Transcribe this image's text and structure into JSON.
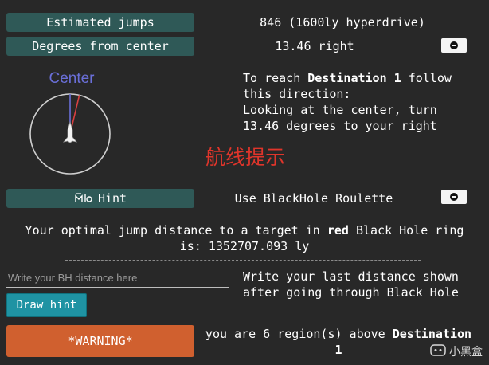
{
  "rows": {
    "jumps": {
      "label": "Estimated jumps",
      "value": "846 (1600ly hyperdrive)"
    },
    "degrees": {
      "label": "Degrees from center",
      "value": "13.46 right"
    }
  },
  "compass": {
    "label": "Center",
    "heading_degrees": 13.46,
    "colors": {
      "center_line": "#7b6ad8",
      "heading_line": "#d84040"
    }
  },
  "instructions": {
    "line1_prefix": "To reach ",
    "destination": "Destination 1",
    "line1_suffix": " follow",
    "line2": "this direction:",
    "line3": "Looking at the center, turn",
    "line4": "13.46 degrees to your right"
  },
  "overlay_caption": "航线提示",
  "hint": {
    "label": "Hint",
    "roulette_text": "Use BlackHole Roulette"
  },
  "optimal": {
    "prefix": "Your optimal jump distance to a target in ",
    "color_word": "red",
    "suffix": " Black Hole ring",
    "line2": "is: 1352707.093 ly"
  },
  "bh_input": {
    "placeholder": "Write your BH distance here",
    "value": ""
  },
  "bh_note": {
    "line1": "Write your last distance shown",
    "line2": "after going through Black Hole"
  },
  "draw_hint_label": "Draw hint",
  "warning": {
    "button": "*WARNING*",
    "text_prefix": "you are 6 region(s) above ",
    "destination": "Destination",
    "line2": "1"
  },
  "watermark": {
    "text": "小黑盒"
  },
  "colors": {
    "pill_bg": "#2f5957",
    "bg": "#282828",
    "caption_red": "#e0352b",
    "warn": "#d0602f",
    "draw": "#1f93a3"
  }
}
